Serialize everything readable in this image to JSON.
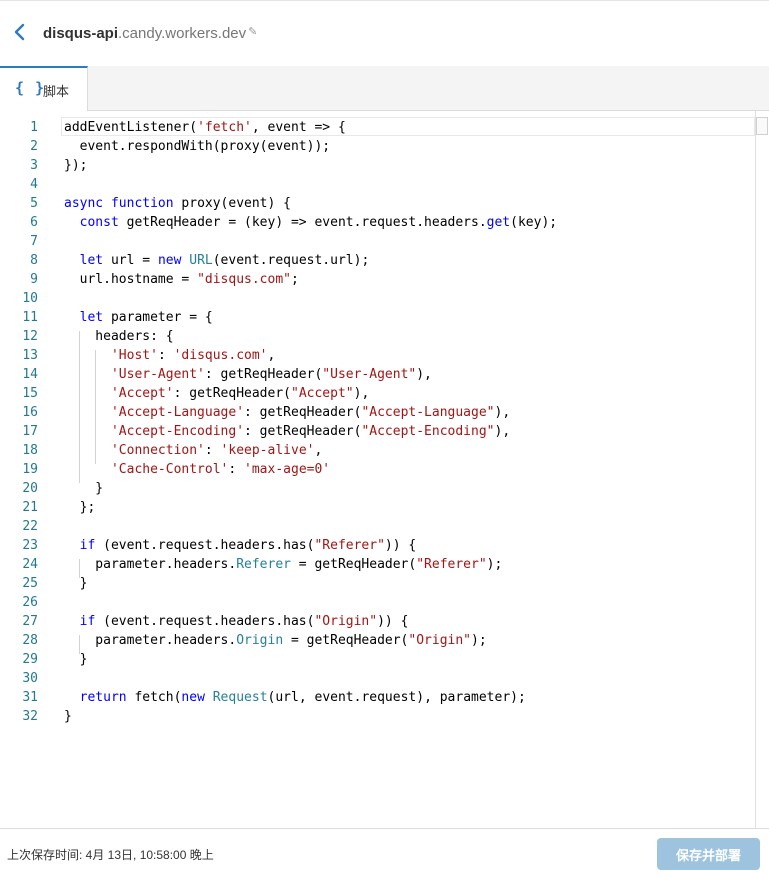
{
  "header": {
    "worker_name": "disqus-api",
    "domain": ".candy.workers.dev",
    "edit_icon": "pencil-icon"
  },
  "tabs": [
    {
      "label": "脚本",
      "icon": "{ }"
    }
  ],
  "editor": {
    "lines": [
      {
        "n": "1",
        "tokens": [
          [
            "",
            "addEventListener("
          ],
          [
            "s",
            "'fetch'"
          ],
          [
            "",
            ", event => {"
          ]
        ]
      },
      {
        "n": "2",
        "tokens": [
          [
            "",
            "  event.respondWith(proxy(event));"
          ]
        ]
      },
      {
        "n": "3",
        "tokens": [
          [
            "",
            "});"
          ]
        ]
      },
      {
        "n": "4",
        "tokens": []
      },
      {
        "n": "5",
        "tokens": [
          [
            "k",
            "async"
          ],
          [
            "",
            " "
          ],
          [
            "k",
            "function"
          ],
          [
            "",
            " proxy(event) {"
          ]
        ]
      },
      {
        "n": "6",
        "tokens": [
          [
            "",
            "  "
          ],
          [
            "k",
            "const"
          ],
          [
            "",
            " getReqHeader = (key) => event.request.headers."
          ],
          [
            "k",
            "get"
          ],
          [
            "",
            "(key);"
          ]
        ]
      },
      {
        "n": "7",
        "tokens": []
      },
      {
        "n": "8",
        "tokens": [
          [
            "",
            "  "
          ],
          [
            "k",
            "let"
          ],
          [
            "",
            " url = "
          ],
          [
            "k",
            "new"
          ],
          [
            "",
            " "
          ],
          [
            "t",
            "URL"
          ],
          [
            "",
            "(event.request.url);"
          ]
        ]
      },
      {
        "n": "9",
        "tokens": [
          [
            "",
            "  url.hostname = "
          ],
          [
            "s",
            "\"disqus.com\""
          ],
          [
            "",
            ";"
          ]
        ]
      },
      {
        "n": "10",
        "tokens": []
      },
      {
        "n": "11",
        "tokens": [
          [
            "",
            "  "
          ],
          [
            "k",
            "let"
          ],
          [
            "",
            " parameter = {"
          ]
        ]
      },
      {
        "n": "12",
        "tokens": [
          [
            "",
            "    headers: {"
          ]
        ]
      },
      {
        "n": "13",
        "tokens": [
          [
            "",
            "      "
          ],
          [
            "s",
            "'Host'"
          ],
          [
            "",
            ": "
          ],
          [
            "s",
            "'disqus.com'"
          ],
          [
            "",
            ","
          ]
        ]
      },
      {
        "n": "14",
        "tokens": [
          [
            "",
            "      "
          ],
          [
            "s",
            "'User-Agent'"
          ],
          [
            "",
            ": getReqHeader("
          ],
          [
            "s",
            "\"User-Agent\""
          ],
          [
            "",
            "),"
          ]
        ]
      },
      {
        "n": "15",
        "tokens": [
          [
            "",
            "      "
          ],
          [
            "s",
            "'Accept'"
          ],
          [
            "",
            ": getReqHeader("
          ],
          [
            "s",
            "\"Accept\""
          ],
          [
            "",
            "),"
          ]
        ]
      },
      {
        "n": "16",
        "tokens": [
          [
            "",
            "      "
          ],
          [
            "s",
            "'Accept-Language'"
          ],
          [
            "",
            ": getReqHeader("
          ],
          [
            "s",
            "\"Accept-Language\""
          ],
          [
            "",
            "),"
          ]
        ]
      },
      {
        "n": "17",
        "tokens": [
          [
            "",
            "      "
          ],
          [
            "s",
            "'Accept-Encoding'"
          ],
          [
            "",
            ": getReqHeader("
          ],
          [
            "s",
            "\"Accept-Encoding\""
          ],
          [
            "",
            "),"
          ]
        ]
      },
      {
        "n": "18",
        "tokens": [
          [
            "",
            "      "
          ],
          [
            "s",
            "'Connection'"
          ],
          [
            "",
            ": "
          ],
          [
            "s",
            "'keep-alive'"
          ],
          [
            "",
            ","
          ]
        ]
      },
      {
        "n": "19",
        "tokens": [
          [
            "",
            "      "
          ],
          [
            "s",
            "'Cache-Control'"
          ],
          [
            "",
            ": "
          ],
          [
            "s",
            "'max-age=0'"
          ]
        ]
      },
      {
        "n": "20",
        "tokens": [
          [
            "",
            "    }"
          ]
        ]
      },
      {
        "n": "21",
        "tokens": [
          [
            "",
            "  };"
          ]
        ]
      },
      {
        "n": "22",
        "tokens": []
      },
      {
        "n": "23",
        "tokens": [
          [
            "",
            "  "
          ],
          [
            "k",
            "if"
          ],
          [
            "",
            " (event.request.headers.has("
          ],
          [
            "s",
            "\"Referer\""
          ],
          [
            "",
            ")) {"
          ]
        ]
      },
      {
        "n": "24",
        "tokens": [
          [
            "",
            "    parameter.headers."
          ],
          [
            "t",
            "Referer"
          ],
          [
            "",
            " = getReqHeader("
          ],
          [
            "s",
            "\"Referer\""
          ],
          [
            "",
            ");"
          ]
        ]
      },
      {
        "n": "25",
        "tokens": [
          [
            "",
            "  }"
          ]
        ]
      },
      {
        "n": "26",
        "tokens": []
      },
      {
        "n": "27",
        "tokens": [
          [
            "",
            "  "
          ],
          [
            "k",
            "if"
          ],
          [
            "",
            " (event.request.headers.has("
          ],
          [
            "s",
            "\"Origin\""
          ],
          [
            "",
            ")) {"
          ]
        ]
      },
      {
        "n": "28",
        "tokens": [
          [
            "",
            "    parameter.headers."
          ],
          [
            "t",
            "Origin"
          ],
          [
            "",
            " = getReqHeader("
          ],
          [
            "s",
            "\"Origin\""
          ],
          [
            "",
            ");"
          ]
        ]
      },
      {
        "n": "29",
        "tokens": [
          [
            "",
            "  }"
          ]
        ]
      },
      {
        "n": "30",
        "tokens": []
      },
      {
        "n": "31",
        "tokens": [
          [
            "",
            "  "
          ],
          [
            "k",
            "return"
          ],
          [
            "",
            " fetch("
          ],
          [
            "k",
            "new"
          ],
          [
            "",
            " "
          ],
          [
            "t",
            "Request"
          ],
          [
            "",
            "(url, event.request), parameter);"
          ]
        ]
      },
      {
        "n": "32",
        "tokens": [
          [
            "",
            "}"
          ]
        ]
      }
    ]
  },
  "footer": {
    "last_saved": "上次保存时间: 4月 13日, 10:58:00 晚上",
    "deploy_label": "保存并部署"
  },
  "colors": {
    "accent": "#2f7bbf",
    "keyword": "#0000ff",
    "string": "#a31515",
    "type": "#267f99",
    "line_number": "#237893",
    "button_disabled": "#9dc3de"
  }
}
